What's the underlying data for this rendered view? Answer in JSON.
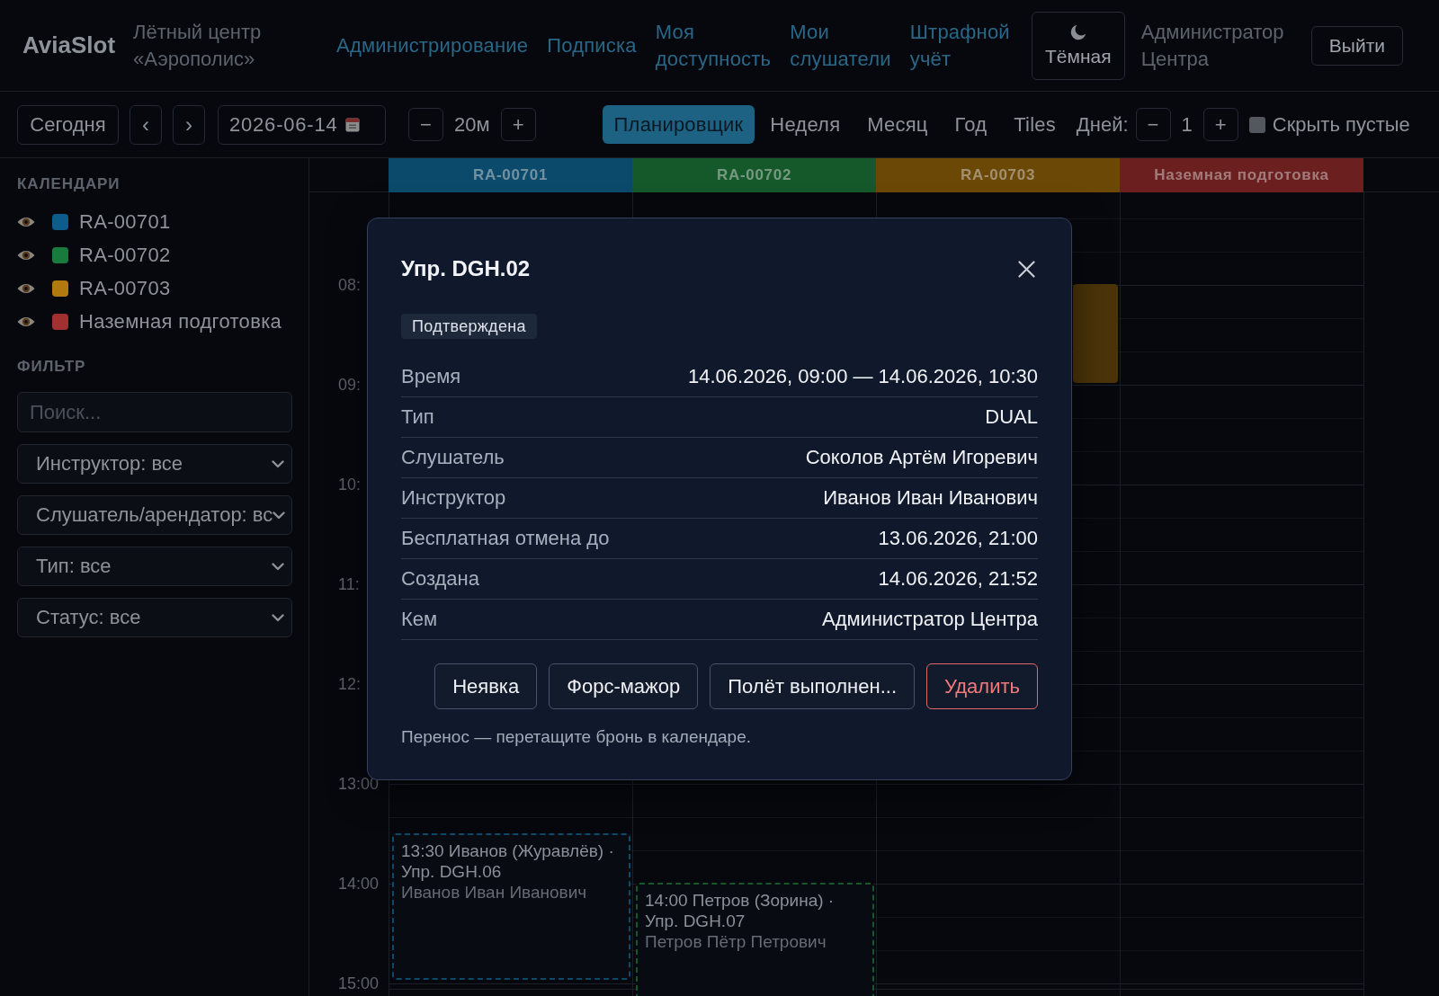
{
  "header": {
    "logo": "AviaSlot",
    "org": "Лётный центр «Аэрополис»",
    "nav": [
      "Администрирование",
      "Подписка",
      "Моя доступность",
      "Мои слушатели",
      "Штрафной учёт"
    ],
    "theme_toggle": {
      "label": "Тёмная"
    },
    "user": "Администратор Центра",
    "logout": "Выйти"
  },
  "toolbar": {
    "today": "Сегодня",
    "prev": "‹",
    "next": "›",
    "date": "2026-06-14",
    "step": {
      "minus": "−",
      "value": "20м",
      "plus": "+"
    },
    "views": [
      {
        "label": "Планировщик",
        "selected": true
      },
      {
        "label": "Неделя",
        "selected": false
      },
      {
        "label": "Месяц",
        "selected": false
      },
      {
        "label": "Год",
        "selected": false
      },
      {
        "label": "Tiles",
        "selected": false
      }
    ],
    "days": {
      "label": "Дней:",
      "minus": "−",
      "value": "1",
      "plus": "+"
    },
    "hide_empty": {
      "label": "Скрыть пустые",
      "checked": false
    }
  },
  "sidebar": {
    "calendars_title": "КАЛЕНДАРИ",
    "calendars": [
      {
        "name": "RA-00701",
        "color": "#0d5c8c",
        "visible": true
      },
      {
        "name": "RA-00702",
        "color": "#187a3c",
        "visible": true
      },
      {
        "name": "RA-00703",
        "color": "#b07a10",
        "visible": true
      },
      {
        "name": "Наземная подготовка",
        "color": "#a23030",
        "visible": true
      }
    ],
    "filter_title": "ФИЛЬТР",
    "search": {
      "placeholder": "Поиск..."
    },
    "selects": [
      "Инструктор: все",
      "Слушатель/арендатор: вс",
      "Тип: все",
      "Статус: все"
    ]
  },
  "calendar": {
    "columns": [
      {
        "name": "RA-00701",
        "color": "#0b4a6b",
        "events": [
          {
            "kind": "tentative",
            "title": "13:30 Иванов (Журавлёв) · Упр. DGH.06",
            "person": "Иванов Иван Иванович"
          }
        ]
      },
      {
        "name": "RA-00702",
        "color": "#15592a",
        "events": [
          {
            "kind": "tentative",
            "title": "14:00 Петров (Зорина) · Упр. DGH.07",
            "person": "Петров Пётр Петрович"
          }
        ]
      },
      {
        "name": "RA-00703",
        "color": "#6b4806",
        "events": [
          {
            "kind": "confirmed"
          }
        ]
      },
      {
        "name": "Наземная подготовка",
        "color": "#6b1f1f"
      }
    ],
    "hours": [
      "08:",
      "09:",
      "10:",
      "11:",
      "12:",
      "13:00",
      "14:00",
      "15:00"
    ]
  },
  "modal": {
    "title": "Упр. DGH.02",
    "status": "Подтверждена",
    "details": [
      {
        "label": "Время",
        "value": "14.06.2026, 09:00 — 14.06.2026, 10:30"
      },
      {
        "label": "Тип",
        "value": "DUAL"
      },
      {
        "label": "Слушатель",
        "value": "Соколов Артём Игоревич"
      },
      {
        "label": "Инструктор",
        "value": "Иванов Иван Иванович"
      },
      {
        "label": "Бесплатная отмена до",
        "value": "13.06.2026, 21:00"
      },
      {
        "label": "Создана",
        "value": "14.06.2026, 21:52"
      },
      {
        "label": "Кем",
        "value": "Администратор Центра"
      }
    ],
    "actions": [
      {
        "label": "Неявка",
        "kind": "default"
      },
      {
        "label": "Форс-мажор",
        "kind": "default"
      },
      {
        "label": "Полёт выполнен...",
        "kind": "default"
      },
      {
        "label": "Удалить",
        "kind": "danger"
      }
    ],
    "note": "Перенос — перетащите бронь в календаре."
  }
}
